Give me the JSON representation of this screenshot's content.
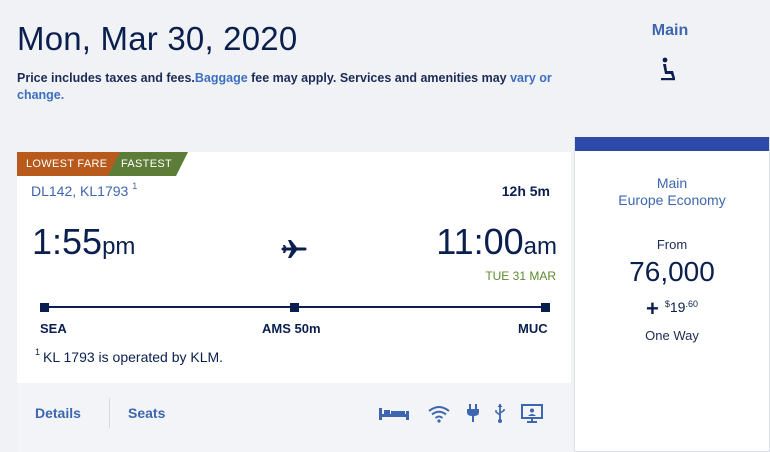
{
  "header": {
    "date": "Mon, Mar 30, 2020",
    "note_prefix": "Price includes taxes and fees.",
    "note_baggage_link": "Baggage",
    "note_middle": " fee may apply. Services and amenities may ",
    "note_vary_link": "vary or change.",
    "cabin_label": "Main"
  },
  "flight": {
    "tag_lowest": "LOWEST FARE",
    "tag_fastest": "FASTEST",
    "flight_numbers": "DL142, KL1793",
    "flight_sup": "1",
    "duration": "12h 5m",
    "dep_time": "1:55",
    "dep_ampm": "pm",
    "arr_time": "11:00",
    "arr_ampm": "am",
    "arr_date": "TUE 31 MAR",
    "origin": "SEA",
    "layover": "AMS 50m",
    "destination": "MUC",
    "footnote_sup": "1",
    "footnote": "KL 1793 is operated by KLM.",
    "details_label": "Details",
    "seats_label": "Seats",
    "amenities": [
      "bed-icon",
      "wifi-icon",
      "power-plug-icon",
      "usb-icon",
      "entertainment-screen-icon"
    ]
  },
  "fare": {
    "cabin": "Main",
    "product": "Europe Economy",
    "from_label": "From",
    "miles": "76,000",
    "plus": "+",
    "fee_currency": "$",
    "fee_amount": "19",
    "fee_cents": ".60",
    "trip_type": "One Way"
  },
  "colors": {
    "navy": "#0b1f4f",
    "link_blue": "#3d66b0",
    "tag_orange": "#b75a1c",
    "tag_green": "#5d7c38",
    "fare_bar": "#2e4aa8",
    "arrival_green": "#5d8a2e"
  }
}
